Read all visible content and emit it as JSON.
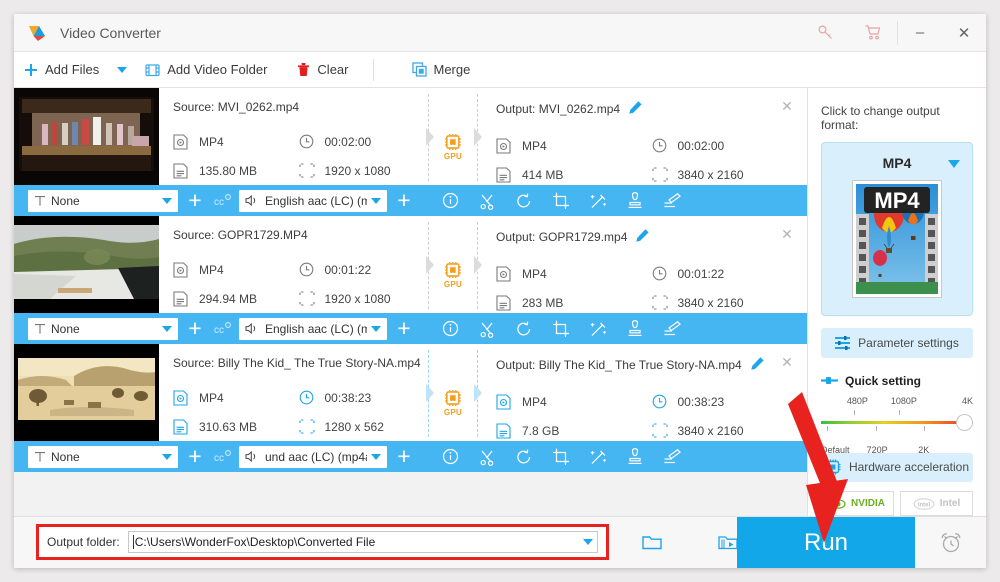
{
  "window": {
    "title": "Video Converter",
    "icons": {
      "key": "key-icon",
      "cart": "cart-icon",
      "minimize": "–",
      "close": "✕"
    }
  },
  "toolbar": {
    "add_files": "Add Files",
    "add_video_folder": "Add Video Folder",
    "clear": "Clear",
    "merge": "Merge"
  },
  "files": [
    {
      "source_label": "Source: MVI_0262.mp4",
      "source_format": "MP4",
      "source_duration": "00:02:00",
      "source_size": "135.80 MB",
      "source_resolution": "1920 x 1080",
      "output_label": "Output: MVI_0262.mp4",
      "output_format": "MP4",
      "output_duration": "00:02:00",
      "output_size": "414 MB",
      "output_resolution": "3840 x 2160",
      "gpu_badge": "GPU",
      "subtitle": "None",
      "audio": "English aac (LC) (m",
      "selected": false
    },
    {
      "source_label": "Source: GOPR1729.MP4",
      "source_format": "MP4",
      "source_duration": "00:01:22",
      "source_size": "294.94 MB",
      "source_resolution": "1920 x 1080",
      "output_label": "Output: GOPR1729.mp4",
      "output_format": "MP4",
      "output_duration": "00:01:22",
      "output_size": "283 MB",
      "output_resolution": "3840 x 2160",
      "gpu_badge": "GPU",
      "subtitle": "None",
      "audio": "English aac (LC) (m",
      "selected": false
    },
    {
      "source_label": "Source: Billy The Kid_ The True Story-NA.mp4",
      "source_format": "MP4",
      "source_duration": "00:38:23",
      "source_size": "310.63 MB",
      "source_resolution": "1280 x 562",
      "output_label": "Output: Billy The Kid_ The True Story-NA.mp4",
      "output_format": "MP4",
      "output_duration": "00:38:23",
      "output_size": "7.8 GB",
      "output_resolution": "3840 x 2160",
      "gpu_badge": "GPU",
      "subtitle": "None",
      "audio": "und aac (LC) (mp4a",
      "selected": true
    }
  ],
  "row_tools": [
    "info-icon",
    "cut-icon",
    "rotate-icon",
    "crop-icon",
    "effects-icon",
    "watermark-icon",
    "subtitle-icon"
  ],
  "panel": {
    "prompt": "Click to change output format:",
    "format_name": "MP4",
    "format_thumb_text": "MP4",
    "parameter_settings": "Parameter settings",
    "quick_setting": "Quick setting",
    "slider": {
      "top_labels": [
        "480P",
        "1080P",
        "4K"
      ],
      "bottom_labels": [
        "Default",
        "720P",
        "2K"
      ],
      "value": "4K"
    },
    "hardware_acceleration": "Hardware acceleration",
    "nvidia": "NVIDIA",
    "intel": "Intel"
  },
  "bottom": {
    "output_folder_label": "Output folder:",
    "output_folder_path": "C:\\Users\\WonderFox\\Desktop\\Converted File",
    "run_label": "Run",
    "open_folder_icon": "folder-icon",
    "video_folder_icon": "video-folder-icon",
    "alarm_icon": "alarm-clock-icon"
  },
  "colors": {
    "accent": "#12a7e8",
    "strip": "#45b6f2",
    "highlight_border": "#e8231f",
    "gpu": "#f59c1a"
  }
}
